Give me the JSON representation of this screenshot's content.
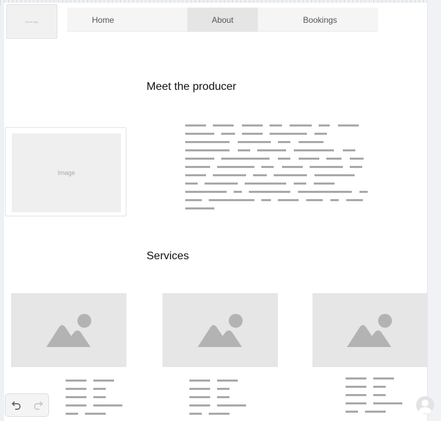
{
  "header": {
    "logo_text": "Some logo",
    "nav": [
      {
        "label": "Home"
      },
      {
        "label": "About"
      },
      {
        "label": "Bookings"
      }
    ]
  },
  "about": {
    "title": "Meet the producer",
    "image_label": "Image"
  },
  "services": {
    "title": "Services"
  },
  "colors": {
    "placeholder_fill": "#e6e6e6",
    "placeholder_icon": "#b3b3b3",
    "text_placeholder": "#a9a9a9",
    "nav_bg": "#f5f5f5",
    "nav_active": "#e5e5e5"
  },
  "icons": {
    "undo": "undo-icon",
    "redo": "redo-icon",
    "user": "user-avatar-icon",
    "image_placeholder": "image-placeholder-icon"
  }
}
